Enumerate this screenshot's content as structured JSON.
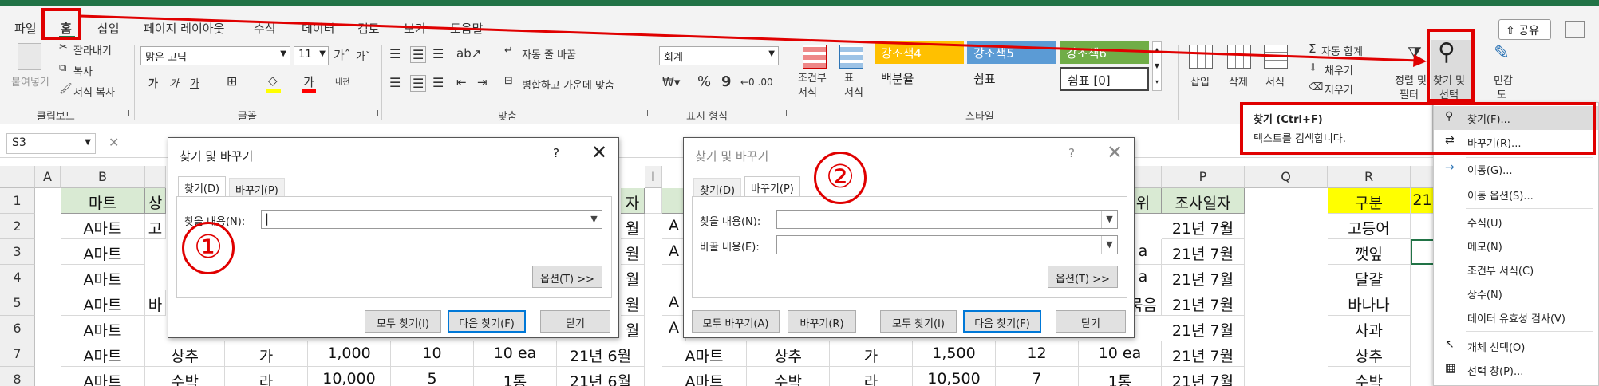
{
  "menu": {
    "tabs": [
      "파일",
      "홈",
      "삽입",
      "페이지 레이아웃",
      "수식",
      "데이터",
      "검토",
      "보기",
      "도움말"
    ],
    "share": "공유"
  },
  "ribbon": {
    "clipboard": {
      "paste": "붙여넣기",
      "cut": "잘라내기",
      "copy": "복사",
      "format_painter": "서식 복사",
      "label": "클립보드"
    },
    "font": {
      "name": "맑은 고딕",
      "size": "11",
      "bold": "가",
      "italic": "가",
      "underline": "가",
      "color_letter": "가",
      "phonetic": "내천",
      "label": "글꼴"
    },
    "alignment": {
      "wrap": "자동 줄 바꿈",
      "merge": "병합하고 가운데 맞춤",
      "label": "맞춤"
    },
    "number": {
      "format": "회계",
      "percent": "%",
      "comma": "9",
      "label": "표시 형식"
    },
    "styles": {
      "conditional": "조건부\n서식",
      "table": "표\n서식",
      "swatches": [
        "강조색4",
        "강조색5",
        "강조색6",
        "백분율",
        "쉼표",
        "쉼표 [0]"
      ],
      "label": "스타일"
    },
    "cells": {
      "insert": "삽입",
      "delete": "삭제",
      "format": "서식"
    },
    "editing": {
      "autosum": "자동 합계",
      "fill": "채우기",
      "clear": "지우기",
      "sort_filter_1": "정렬 및",
      "sort_filter_2": "필터",
      "find_select_1": "찾기 및",
      "find_select_2": "선택"
    },
    "sensitivity_1": "민감",
    "sensitivity_2": "도"
  },
  "formula_bar": {
    "name_box": "S3",
    "cancel": "✕"
  },
  "sheet": {
    "columns": [
      "A",
      "B",
      "",
      "",
      "",
      "",
      "",
      "",
      "",
      "I",
      "",
      "",
      "",
      "",
      "",
      "",
      "P",
      "Q",
      "R",
      ""
    ],
    "rows": [
      "1",
      "2",
      "3",
      "4",
      "5",
      "6",
      "7",
      "8"
    ],
    "left_headers": {
      "b1": "마트",
      "c1": "상",
      "i1": "자"
    },
    "b_col": [
      "A마트",
      "A마트",
      "A마트",
      "A마트",
      "A마트",
      "A마트",
      "A마트"
    ],
    "c_partial": [
      "고",
      "",
      "",
      "바",
      "",
      "상추",
      "수박"
    ],
    "row7": [
      "가",
      "1,000",
      "10",
      "10 ea",
      "21년 6월"
    ],
    "row8": [
      "라",
      "10,000",
      "5",
      "1통",
      "21년 6월"
    ],
    "h_col": [
      "월",
      "월",
      "월",
      "월",
      "월"
    ],
    "right_row7": [
      "A마트",
      "상추",
      "가",
      "1,500",
      "12",
      "10 ea"
    ],
    "right_row8": [
      "A마트",
      "수박",
      "라",
      "10,500",
      "7",
      "1통"
    ],
    "o_partial": [
      "위",
      "",
      "a",
      "a",
      "묶음",
      ""
    ],
    "p_header": "조사일자",
    "p_col": [
      "21년 7월",
      "21년 7월",
      "21년 7월",
      "21년 7월",
      "21년 7월",
      "21년 7월",
      "21년 7월"
    ],
    "r_header": "구분",
    "r_col": [
      "고등어",
      "깻잎",
      "달걀",
      "바나나",
      "사과",
      "상추",
      "수박"
    ],
    "s_header": "21",
    "left_k_partial": [
      "A",
      "A",
      "",
      "A",
      "A"
    ]
  },
  "dialog1": {
    "title": "찾기 및 바꾸기",
    "help": "?",
    "close": "✕",
    "tabs": [
      "찾기(D)",
      "바꾸기(P)"
    ],
    "find_label": "찾을 내용(N):",
    "options": "옵션(T) >>",
    "find_all": "모두 찾기(I)",
    "find_next": "다음 찾기(F)",
    "close_btn": "닫기"
  },
  "dialog2": {
    "title": "찾기 및 바꾸기",
    "help": "?",
    "close": "✕",
    "tabs": [
      "찾기(D)",
      "바꾸기(P)"
    ],
    "find_label": "찾을 내용(N):",
    "replace_label": "바꿀 내용(E):",
    "options": "옵션(T) >>",
    "replace_all": "모두 바꾸기(A)",
    "replace": "바꾸기(R)",
    "find_all": "모두 찾기(I)",
    "find_next": "다음 찾기(F)",
    "close_btn": "닫기"
  },
  "annotations": {
    "one": "①",
    "two": "②"
  },
  "tooltip": {
    "title": "찾기 (Ctrl+F)",
    "desc": "텍스트를 검색합니다."
  },
  "dropdown": {
    "items": [
      "찾기(F)...",
      "바꾸기(R)...",
      "이동(G)...",
      "이동 옵션(S)...",
      "수식(U)",
      "메모(N)",
      "조건부 서식(C)",
      "상수(N)",
      "데이터 유효성 검사(V)",
      "개체 선택(O)",
      "선택 창(P)..."
    ]
  },
  "colors": {
    "excel_green": "#217346",
    "annotation_red": "#e00000",
    "header_fill": "#d9ead3",
    "highlight": "#ffff00"
  }
}
